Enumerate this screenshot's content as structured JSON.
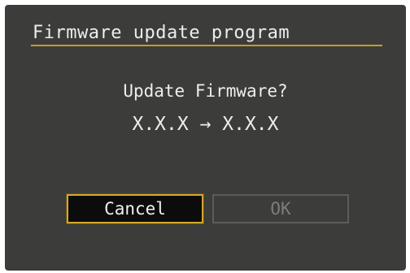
{
  "dialog": {
    "title": "Firmware update program",
    "prompt": "Update Firmware?",
    "version_change": "X.X.X → X.X.X"
  },
  "buttons": {
    "cancel_label": "Cancel",
    "ok_label": "OK"
  },
  "colors": {
    "background": "#3c3c3a",
    "accent": "#c59a2a",
    "text": "#ededed",
    "disabled_text": "#7d7d7b"
  }
}
